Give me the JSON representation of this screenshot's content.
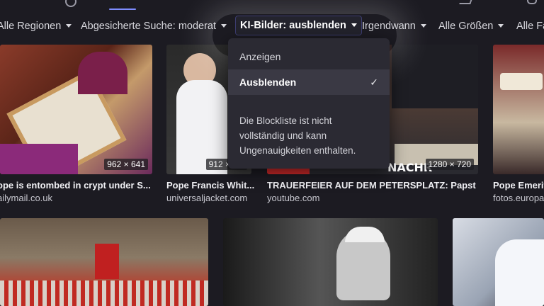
{
  "filters": {
    "region": "Alle Regionen",
    "safe_search": "Abgesicherte Suche: moderat",
    "ai_images": "KI-Bilder: ausblenden",
    "time": "Irgendwann",
    "size": "Alle Größen",
    "color": "Alle Fa"
  },
  "dropdown": {
    "option_show": "Anzeigen",
    "option_hide": "Ausblenden",
    "selected_check": "✓",
    "note": "Die Blockliste ist nicht vollständig und kann Ungenauigkeiten enthalten."
  },
  "results": [
    {
      "title": "ope is entombed in crypt under S...",
      "source": "ailymail.co.uk",
      "dimensions": "962 × 641"
    },
    {
      "title": "Pope Francis Whit...",
      "source": "universaljacket.com",
      "dimensions": "912 × 1..."
    },
    {
      "title": "TRAUERFEIER AUF DEM PETERSPLATZ: Papst ...",
      "source": "youtube.com",
      "dimensions": "1280 × 720",
      "overlay_text": "NACHR"
    },
    {
      "title": "Pope Emerit",
      "source": "fotos.europa"
    }
  ],
  "icons": {
    "search": "search-icon",
    "chevron": "chevron-down-icon",
    "check": "checkmark-icon"
  }
}
